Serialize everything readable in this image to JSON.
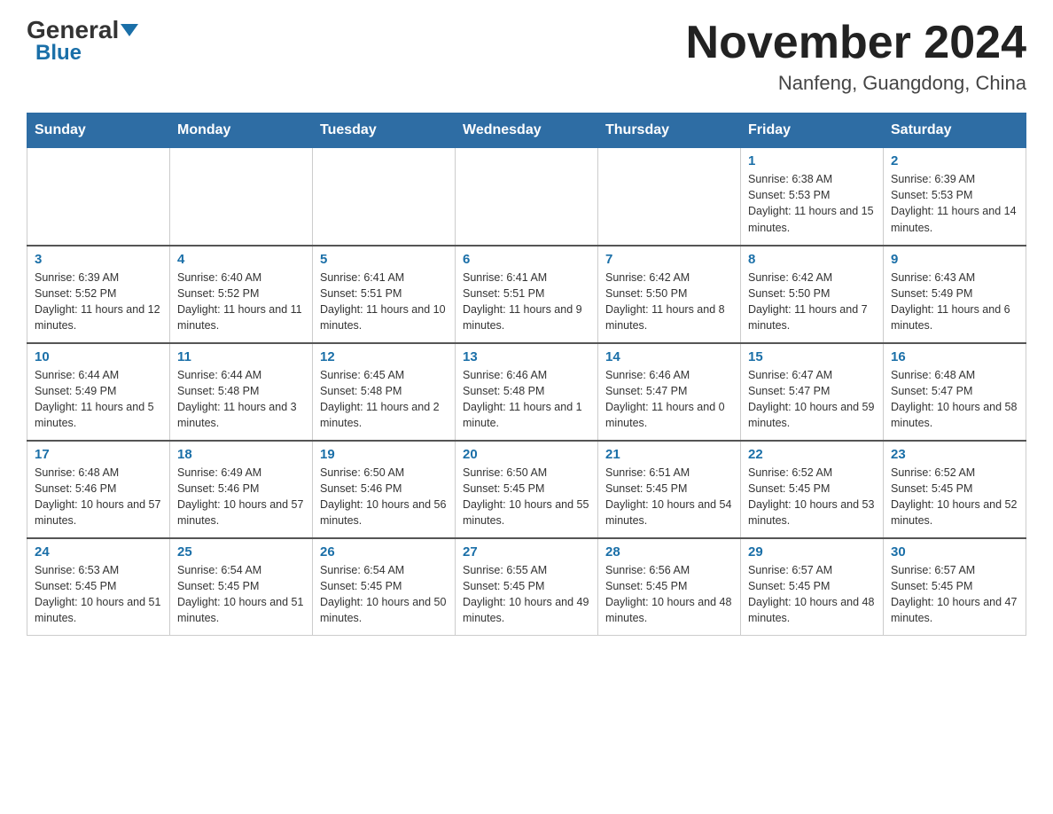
{
  "header": {
    "logo_general": "General",
    "logo_blue": "Blue",
    "month_title": "November 2024",
    "location": "Nanfeng, Guangdong, China"
  },
  "days_of_week": [
    "Sunday",
    "Monday",
    "Tuesday",
    "Wednesday",
    "Thursday",
    "Friday",
    "Saturday"
  ],
  "weeks": [
    [
      {
        "day": "",
        "info": ""
      },
      {
        "day": "",
        "info": ""
      },
      {
        "day": "",
        "info": ""
      },
      {
        "day": "",
        "info": ""
      },
      {
        "day": "",
        "info": ""
      },
      {
        "day": "1",
        "info": "Sunrise: 6:38 AM\nSunset: 5:53 PM\nDaylight: 11 hours and 15 minutes."
      },
      {
        "day": "2",
        "info": "Sunrise: 6:39 AM\nSunset: 5:53 PM\nDaylight: 11 hours and 14 minutes."
      }
    ],
    [
      {
        "day": "3",
        "info": "Sunrise: 6:39 AM\nSunset: 5:52 PM\nDaylight: 11 hours and 12 minutes."
      },
      {
        "day": "4",
        "info": "Sunrise: 6:40 AM\nSunset: 5:52 PM\nDaylight: 11 hours and 11 minutes."
      },
      {
        "day": "5",
        "info": "Sunrise: 6:41 AM\nSunset: 5:51 PM\nDaylight: 11 hours and 10 minutes."
      },
      {
        "day": "6",
        "info": "Sunrise: 6:41 AM\nSunset: 5:51 PM\nDaylight: 11 hours and 9 minutes."
      },
      {
        "day": "7",
        "info": "Sunrise: 6:42 AM\nSunset: 5:50 PM\nDaylight: 11 hours and 8 minutes."
      },
      {
        "day": "8",
        "info": "Sunrise: 6:42 AM\nSunset: 5:50 PM\nDaylight: 11 hours and 7 minutes."
      },
      {
        "day": "9",
        "info": "Sunrise: 6:43 AM\nSunset: 5:49 PM\nDaylight: 11 hours and 6 minutes."
      }
    ],
    [
      {
        "day": "10",
        "info": "Sunrise: 6:44 AM\nSunset: 5:49 PM\nDaylight: 11 hours and 5 minutes."
      },
      {
        "day": "11",
        "info": "Sunrise: 6:44 AM\nSunset: 5:48 PM\nDaylight: 11 hours and 3 minutes."
      },
      {
        "day": "12",
        "info": "Sunrise: 6:45 AM\nSunset: 5:48 PM\nDaylight: 11 hours and 2 minutes."
      },
      {
        "day": "13",
        "info": "Sunrise: 6:46 AM\nSunset: 5:48 PM\nDaylight: 11 hours and 1 minute."
      },
      {
        "day": "14",
        "info": "Sunrise: 6:46 AM\nSunset: 5:47 PM\nDaylight: 11 hours and 0 minutes."
      },
      {
        "day": "15",
        "info": "Sunrise: 6:47 AM\nSunset: 5:47 PM\nDaylight: 10 hours and 59 minutes."
      },
      {
        "day": "16",
        "info": "Sunrise: 6:48 AM\nSunset: 5:47 PM\nDaylight: 10 hours and 58 minutes."
      }
    ],
    [
      {
        "day": "17",
        "info": "Sunrise: 6:48 AM\nSunset: 5:46 PM\nDaylight: 10 hours and 57 minutes."
      },
      {
        "day": "18",
        "info": "Sunrise: 6:49 AM\nSunset: 5:46 PM\nDaylight: 10 hours and 57 minutes."
      },
      {
        "day": "19",
        "info": "Sunrise: 6:50 AM\nSunset: 5:46 PM\nDaylight: 10 hours and 56 minutes."
      },
      {
        "day": "20",
        "info": "Sunrise: 6:50 AM\nSunset: 5:45 PM\nDaylight: 10 hours and 55 minutes."
      },
      {
        "day": "21",
        "info": "Sunrise: 6:51 AM\nSunset: 5:45 PM\nDaylight: 10 hours and 54 minutes."
      },
      {
        "day": "22",
        "info": "Sunrise: 6:52 AM\nSunset: 5:45 PM\nDaylight: 10 hours and 53 minutes."
      },
      {
        "day": "23",
        "info": "Sunrise: 6:52 AM\nSunset: 5:45 PM\nDaylight: 10 hours and 52 minutes."
      }
    ],
    [
      {
        "day": "24",
        "info": "Sunrise: 6:53 AM\nSunset: 5:45 PM\nDaylight: 10 hours and 51 minutes."
      },
      {
        "day": "25",
        "info": "Sunrise: 6:54 AM\nSunset: 5:45 PM\nDaylight: 10 hours and 51 minutes."
      },
      {
        "day": "26",
        "info": "Sunrise: 6:54 AM\nSunset: 5:45 PM\nDaylight: 10 hours and 50 minutes."
      },
      {
        "day": "27",
        "info": "Sunrise: 6:55 AM\nSunset: 5:45 PM\nDaylight: 10 hours and 49 minutes."
      },
      {
        "day": "28",
        "info": "Sunrise: 6:56 AM\nSunset: 5:45 PM\nDaylight: 10 hours and 48 minutes."
      },
      {
        "day": "29",
        "info": "Sunrise: 6:57 AM\nSunset: 5:45 PM\nDaylight: 10 hours and 48 minutes."
      },
      {
        "day": "30",
        "info": "Sunrise: 6:57 AM\nSunset: 5:45 PM\nDaylight: 10 hours and 47 minutes."
      }
    ]
  ]
}
